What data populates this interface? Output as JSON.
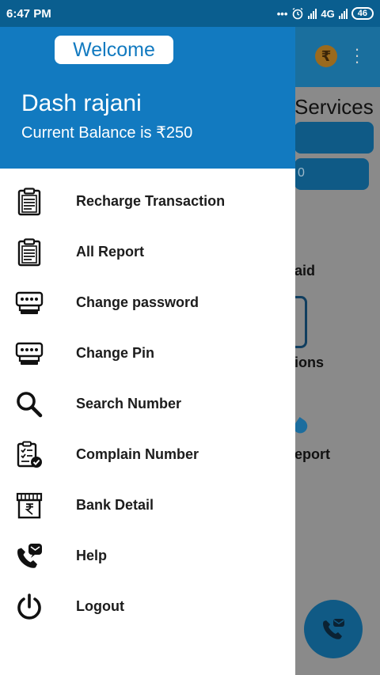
{
  "status_bar": {
    "time": "6:47 PM",
    "icons": [
      "more-dots-icon",
      "alarm-icon",
      "signal-icon",
      "signal-icon-2"
    ],
    "network": "4G",
    "battery": "46"
  },
  "background": {
    "services_title": "Services",
    "bar2_text": "0",
    "text_aid": "aid",
    "text_ions": "ions",
    "text_eport": "eport",
    "rupee_symbol": "₹"
  },
  "drawer": {
    "welcome": "Welcome",
    "user_name": "Dash rajani",
    "balance_label": "Current Balance is",
    "currency_symbol": "₹",
    "balance_value": "250",
    "items": [
      {
        "label": "Recharge Transaction",
        "icon": "clipboard-report-icon"
      },
      {
        "label": "All Report",
        "icon": "clipboard-report-icon"
      },
      {
        "label": "Change password",
        "icon": "password-keypad-icon"
      },
      {
        "label": "Change Pin",
        "icon": "pin-keypad-icon"
      },
      {
        "label": "Search Number",
        "icon": "search-icon"
      },
      {
        "label": "Complain Number",
        "icon": "complaint-clipboard-icon"
      },
      {
        "label": "Bank Detail",
        "icon": "bank-rupee-icon"
      },
      {
        "label": "Help",
        "icon": "phone-mail-icon"
      },
      {
        "label": "Logout",
        "icon": "power-icon"
      }
    ]
  },
  "colors": {
    "drawer_header": "#127ac0",
    "status_bar": "#0a5e8f",
    "text": "#1c1c1c"
  }
}
